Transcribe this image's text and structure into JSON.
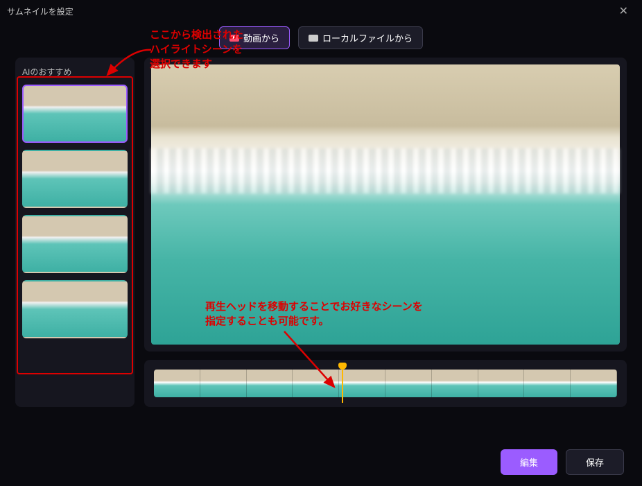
{
  "window": {
    "title": "サムネイルを設定"
  },
  "tabs": {
    "video": "動画から",
    "local": "ローカルファイルから"
  },
  "sidebar": {
    "title": "AIのおすすめ"
  },
  "buttons": {
    "edit": "編集",
    "save": "保存"
  },
  "annotations": {
    "a1_line1": "ここから検出された",
    "a1_line2": "ハイライトシーンを",
    "a1_line3": "選択できます",
    "a2_line1": "再生ヘッドを移動することでお好きなシーンを",
    "a2_line2": "指定することも可能です。"
  },
  "timeline": {
    "num_cells": 10,
    "playhead_percent": 41
  }
}
